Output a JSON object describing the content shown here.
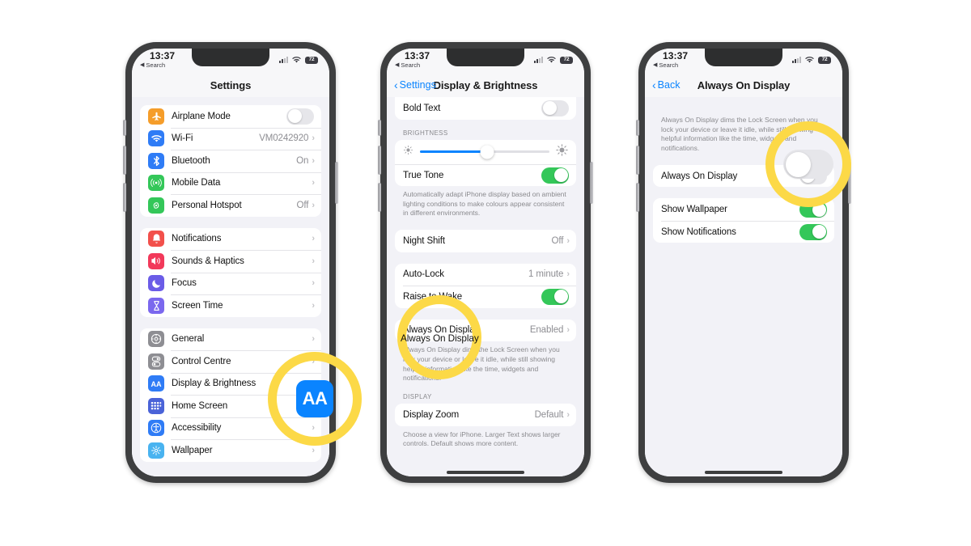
{
  "status_bar": {
    "time": "13:37",
    "back_label": "Search",
    "battery": "72"
  },
  "phone1": {
    "nav_title": "Settings",
    "groups": [
      {
        "rows": [
          {
            "label": "Airplane Mode",
            "icon": "airplane-icon",
            "icon_color": "#f59d2a",
            "control": "toggle-off"
          },
          {
            "label": "Wi-Fi",
            "icon": "wifi-icon",
            "icon_color": "#2f7cf6",
            "value": "VM0242920",
            "control": "chevron"
          },
          {
            "label": "Bluetooth",
            "icon": "bluetooth-icon",
            "icon_color": "#2f7cf6",
            "value": "On",
            "control": "chevron"
          },
          {
            "label": "Mobile Data",
            "icon": "mobile-data-icon",
            "icon_color": "#34c759",
            "value": "",
            "control": "chevron"
          },
          {
            "label": "Personal Hotspot",
            "icon": "hotspot-icon",
            "icon_color": "#34c759",
            "value": "Off",
            "control": "chevron"
          }
        ]
      },
      {
        "rows": [
          {
            "label": "Notifications",
            "icon": "bell-icon",
            "icon_color": "#f2504b",
            "value": "",
            "control": "chevron"
          },
          {
            "label": "Sounds & Haptics",
            "icon": "speaker-icon",
            "icon_color": "#f2395a",
            "value": "",
            "control": "chevron"
          },
          {
            "label": "Focus",
            "icon": "moon-icon",
            "icon_color": "#6b5ce7",
            "value": "",
            "control": "chevron"
          },
          {
            "label": "Screen Time",
            "icon": "hourglass-icon",
            "icon_color": "#7b68ee",
            "value": "",
            "control": "chevron"
          }
        ]
      },
      {
        "rows": [
          {
            "label": "General",
            "icon": "gear-icon",
            "icon_color": "#8e8e93",
            "value": "",
            "control": "chevron"
          },
          {
            "label": "Control Centre",
            "icon": "control-centre-icon",
            "icon_color": "#8e8e93",
            "value": "",
            "control": "chevron"
          },
          {
            "label": "Display & Brightness",
            "icon": "display-brightness-icon",
            "icon_color": "#2f7cf6",
            "value": "",
            "control": "chevron"
          },
          {
            "label": "Home Screen",
            "icon": "home-screen-icon",
            "icon_color": "#4a63d8",
            "value": "",
            "control": "chevron"
          },
          {
            "label": "Accessibility",
            "icon": "accessibility-icon",
            "icon_color": "#2f7cf6",
            "value": "",
            "control": "chevron"
          },
          {
            "label": "Wallpaper",
            "icon": "wallpaper-icon",
            "icon_color": "#49b3f0",
            "value": "",
            "control": "chevron"
          }
        ]
      }
    ]
  },
  "phone2": {
    "nav_back": "Settings",
    "nav_title": "Display & Brightness",
    "bold_text_label": "Bold Text",
    "brightness_header": "BRIGHTNESS",
    "brightness_percent": 52,
    "true_tone_label": "True Tone",
    "true_tone_footnote": "Automatically adapt iPhone display based on ambient lighting conditions to make colours appear consistent in different environments.",
    "night_shift_label": "Night Shift",
    "night_shift_value": "Off",
    "auto_lock_label": "Auto-Lock",
    "auto_lock_value": "1 minute",
    "raise_to_wake_label": "Raise to Wake",
    "always_on_label": "Always On Display",
    "always_on_value": "Enabled",
    "always_on_footnote": "Always On Display dims the Lock Screen when you lock your device or leave it idle, while still showing helpful information like the time, widgets and notifications.",
    "display_header": "DISPLAY",
    "display_zoom_label": "Display Zoom",
    "display_zoom_value": "Default",
    "display_zoom_footnote": "Choose a view for iPhone. Larger Text shows larger controls. Default shows more content."
  },
  "phone3": {
    "nav_back": "Back",
    "nav_title": "Always On Display",
    "intro_footnote": "Always On Display dims the Lock Screen when you lock your device or leave it idle, while still showing helpful information like the time, widgets and notifications.",
    "always_on_label": "Always On Display",
    "show_wallpaper_label": "Show Wallpaper",
    "show_notifications_label": "Show Notifications"
  },
  "highlights": {
    "color": "#fcd947",
    "tile_label": "AA",
    "tile_color": "#0a84ff",
    "circle2_text": "Always On Display"
  }
}
